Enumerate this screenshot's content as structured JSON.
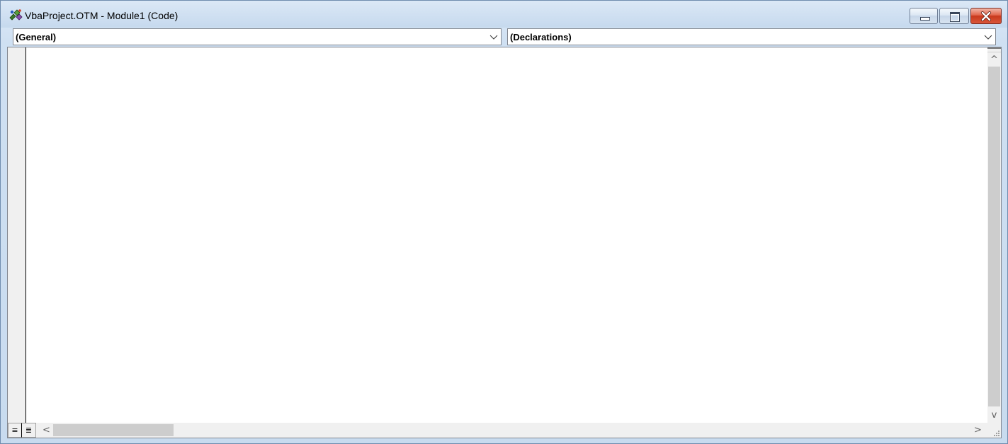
{
  "window": {
    "title": "VbaProject.OTM - Module1 (Code)",
    "controls": {
      "minimize": "minimize",
      "maximize": "maximize",
      "close": "close"
    }
  },
  "object_combo": {
    "value": "(General)"
  },
  "procedure_combo": {
    "value": "(Declarations)"
  },
  "code_pane": {
    "content": ""
  },
  "icons": {
    "app": "vba-project-icon",
    "dropdown": "chevron-down-icon",
    "scroll_up": "arrow-up-icon",
    "scroll_down": "arrow-down-icon",
    "scroll_left": "arrow-left-icon",
    "scroll_right": "arrow-right-icon",
    "procedure_view": "procedure-view-icon",
    "full_module_view": "full-module-view-icon",
    "size_grip": "size-grip-icon"
  },
  "glyphs": {
    "up": "^",
    "down": "v",
    "left": "<",
    "right": ">",
    "procedure_view": "≡",
    "full_module_view": "≣"
  },
  "colors": {
    "title_bar": "#c6d9ee",
    "close_button": "#c8381c",
    "scroll_track": "#f0f0f0",
    "scroll_thumb": "#cdcdcd"
  }
}
